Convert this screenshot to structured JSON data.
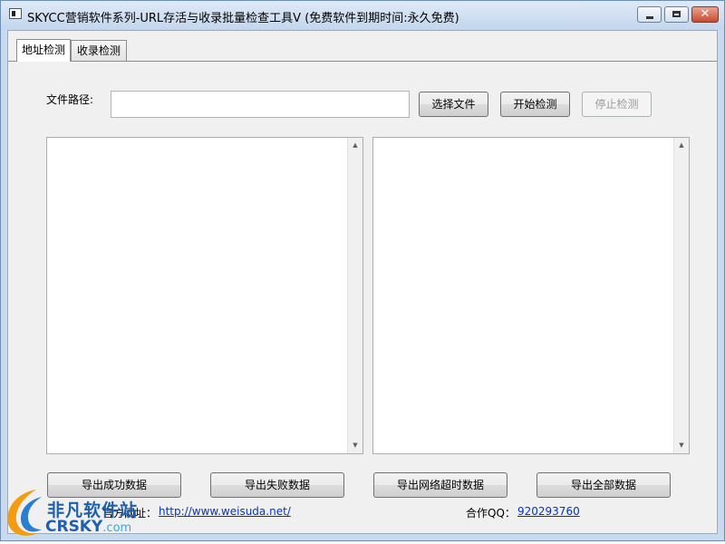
{
  "window": {
    "title": "SKYCC营销软件系列-URL存活与收录批量检查工具V (免费软件到期时间:永久免费)",
    "close_glyph": "✕"
  },
  "tabs": [
    {
      "label": "地址检测",
      "active": true
    },
    {
      "label": "收录检测",
      "active": false
    }
  ],
  "file": {
    "label": "文件路径:",
    "value": "",
    "placeholder": ""
  },
  "toolbar": {
    "select_file": "选择文件",
    "start_check": "开始检测",
    "stop_check": "停止检测"
  },
  "scrollbar": {
    "up_arrow": "▲",
    "down_arrow": "▼"
  },
  "export_buttons": {
    "success": "导出成功数据",
    "failed": "导出失败数据",
    "timeout": "导出网络超时数据",
    "all": "导出全部数据"
  },
  "footer": {
    "site_label": "官方网址：",
    "site_url": "http://www.weisuda.net/",
    "qq_label": "合作QQ：",
    "qq_number": "920293760"
  },
  "watermark": {
    "cn": "非凡软件站",
    "en": "CRSKY",
    "en_suffix": ".com"
  },
  "colors": {
    "link": "#0033cc",
    "watermark": "#1e5fb0",
    "close_button": "#c74b30"
  }
}
